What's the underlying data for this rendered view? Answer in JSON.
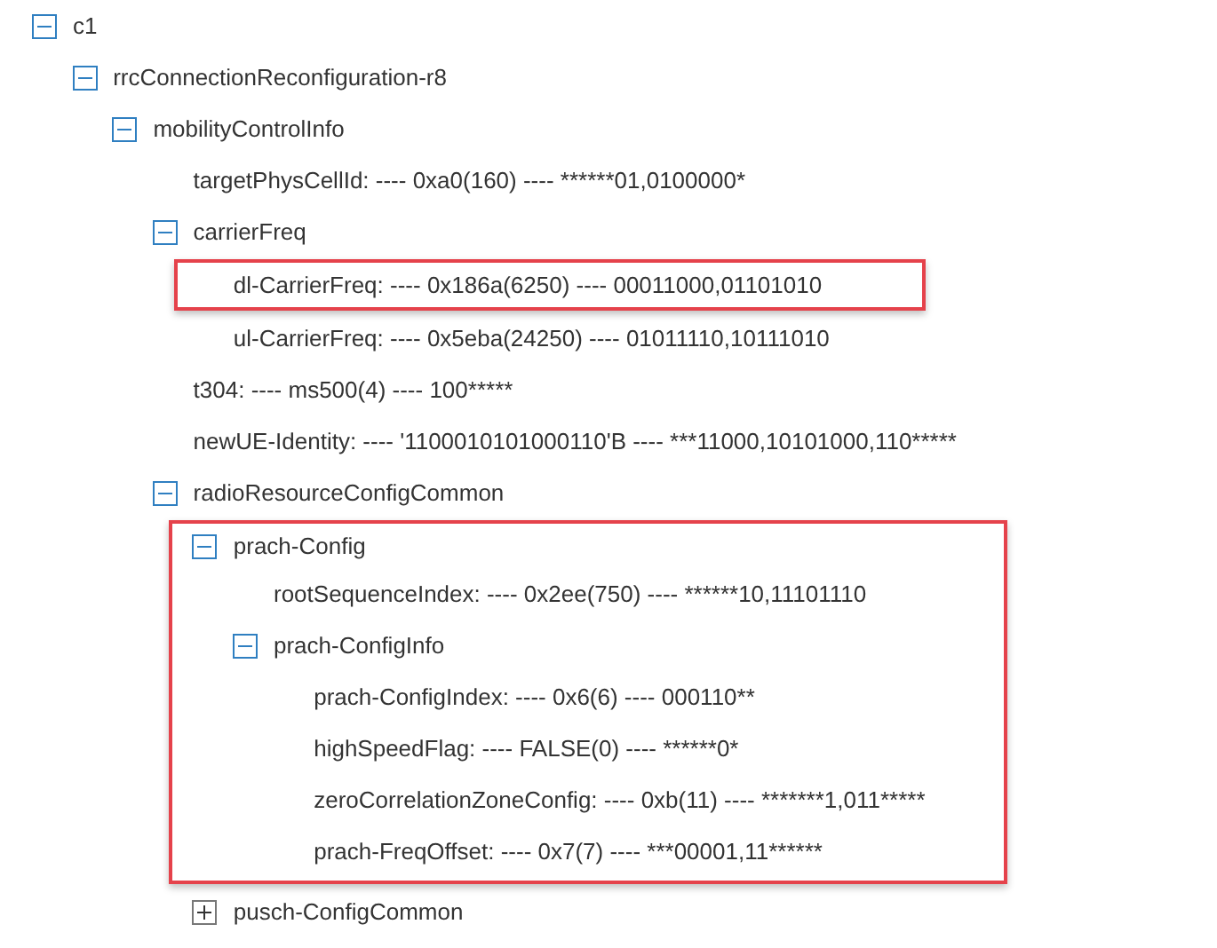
{
  "tree": [
    {
      "label": "c1",
      "expanded": true,
      "highlighted": false,
      "children": [
        {
          "label": "rrcConnectionReconfiguration-r8",
          "expanded": true,
          "highlighted": false,
          "children": [
            {
              "label": "mobilityControlInfo",
              "expanded": true,
              "highlighted": false,
              "children": [
                {
                  "label": "targetPhysCellId: ---- 0xa0(160) ---- ******01,0100000*",
                  "highlighted": false
                },
                {
                  "label": "carrierFreq",
                  "expanded": true,
                  "highlighted": false,
                  "children": [
                    {
                      "label": "dl-CarrierFreq: ---- 0x186a(6250) ---- 00011000,01101010",
                      "highlighted": true
                    },
                    {
                      "label": "ul-CarrierFreq: ---- 0x5eba(24250) ---- 01011110,10111010",
                      "highlighted": false
                    }
                  ]
                },
                {
                  "label": "t304: ---- ms500(4) ---- 100*****",
                  "highlighted": false
                },
                {
                  "label": "newUE-Identity: ---- '1100010101000110'B ---- ***11000,10101000,110*****",
                  "highlighted": false
                },
                {
                  "label": "radioResourceConfigCommon",
                  "expanded": true,
                  "highlighted": false,
                  "children": [
                    {
                      "label": "prach-Config",
                      "expanded": true,
                      "highlighted": true,
                      "children": [
                        {
                          "label": "rootSequenceIndex: ---- 0x2ee(750) ---- ******10,11101110",
                          "highlighted": false
                        },
                        {
                          "label": "prach-ConfigInfo",
                          "expanded": true,
                          "highlighted": false,
                          "children": [
                            {
                              "label": "prach-ConfigIndex: ---- 0x6(6) ---- 000110**",
                              "highlighted": false
                            },
                            {
                              "label": "highSpeedFlag: ---- FALSE(0) ---- ******0*",
                              "highlighted": false
                            },
                            {
                              "label": "zeroCorrelationZoneConfig: ---- 0xb(11) ---- *******1,011*****",
                              "highlighted": false
                            },
                            {
                              "label": "prach-FreqOffset: ---- 0x7(7) ---- ***00001,11******",
                              "highlighted": false
                            }
                          ]
                        }
                      ]
                    },
                    {
                      "label": "pusch-ConfigCommon",
                      "expanded": false,
                      "highlighted": false
                    }
                  ]
                }
              ]
            }
          ]
        }
      ]
    }
  ]
}
